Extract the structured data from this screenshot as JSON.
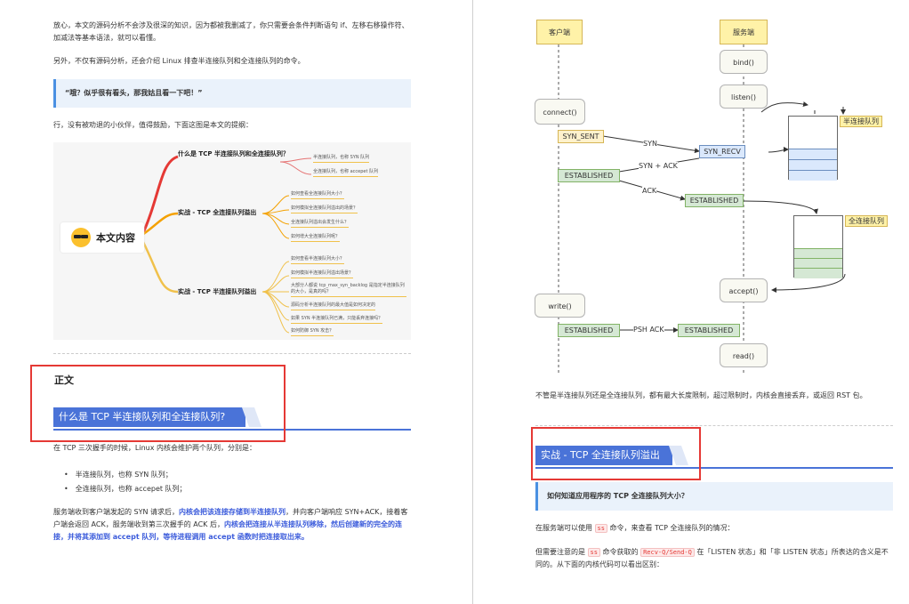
{
  "left_page": {
    "intro1": "放心，本文的源码分析不会涉及很深的知识，因为都被我删减了，你只需要会条件判断语句 if、左移右移操作符、加减法等基本语法，就可以看懂。",
    "intro2": "另外，不仅有源码分析，还会介绍 Linux 排查半连接队列和全连接队列的命令。",
    "quote": "“哦？似乎很有看头，那我姑且看一下吧！”",
    "intro3": "行，没有被劝退的小伙伴，值得鼓励，下面这图是本文的提纲：",
    "mindmap": {
      "center": "本文内容",
      "branch1": "什么是 TCP 半连接队列和全连接队列？",
      "branch1_leaves": [
        "半连接队列，也称 SYN 队列",
        "全连接队列，也称 accepet 队列"
      ],
      "branch2": "实战 - TCP 全连接队列溢出",
      "branch2_leaves": [
        "如何查看全连接队列大小？",
        "如何模拟全连接队列溢出的场景？",
        "全连接队列溢出会发生什么？",
        "如何增大全连接队列呢？"
      ],
      "branch3": "实战 - TCP 半连接队列溢出",
      "branch3_leaves": [
        "如何查看半连接队列大小？",
        "如何模拟半连接队列溢出场景？",
        "大部分人都说 tcp_max_syn_backlog 是指定半连接队列的大小，是真的吗？",
        "源码分析半连接队列的最大值是如何决定的",
        "如果 SYN 半连接队列已满，只能丢弃连接吗？",
        "如何防御 SYN 攻击？"
      ]
    },
    "section_title": "正文",
    "banner": "什么是 TCP 半连接队列和全连接队列?",
    "para1": "在 TCP 三次握手的时候，Linux 内核会维护两个队列，分别是：",
    "bullets": [
      "半连接队列，也称 SYN 队列；",
      "全连接队列，也称 accepet 队列；"
    ],
    "para2_a": "服务端收到客户端发起的 SYN 请求后，",
    "para2_b": "内核会把该连接存储到半连接队列",
    "para2_c": "，并向客户端响应 SYN+ACK，接着客户端会返回 ACK，服务端收到第三次握手的 ACK 后，",
    "para2_d": "内核会把连接从半连接队列移除，然后创建新的完全的连接，并将其添加到 accept 队列，等待进程调用 accept 函数时把连接取出来。"
  },
  "right_page": {
    "diagram": {
      "client": "客户端",
      "server": "服务端",
      "bind": "bind()",
      "listen": "listen()",
      "connect": "connect()",
      "syn_sent": "SYN_SENT",
      "syn": "SYN",
      "syn_recv": "SYN_RECV",
      "syn_ack": "SYN + ACK",
      "established_c": "ESTABLISHED",
      "ack": "ACK",
      "established_s": "ESTABLISHED",
      "half_queue": "半连接队列",
      "full_queue": "全连接队列",
      "accept": "accept()",
      "write": "write()",
      "established_w": "ESTABLISHED",
      "psh_ack": "PSH ACK",
      "established_r": "ESTABLISHED",
      "read": "read()"
    },
    "para1": "不管是半连接队列还是全连接队列，都有最大长度限制，超过限制时，内核会直接丢弃，或返回 RST 包。",
    "banner": "实战 - TCP 全连接队列溢出",
    "quote": "如何知道应用程序的 TCP 全连接队列大小？",
    "para2_a": "在服务端可以使用",
    "code_ss": "ss",
    "para2_b": "命令，来查看 TCP 全连接队列的情况：",
    "para3_a": "但需要注意的是",
    "para3_b": "命令获取的",
    "code_recv": "Recv-Q/Send-Q",
    "para3_c": "在「LISTEN 状态」和「非 LISTEN 状态」所表达的含义是不同的。从下面的内核代码可以看出区别："
  }
}
